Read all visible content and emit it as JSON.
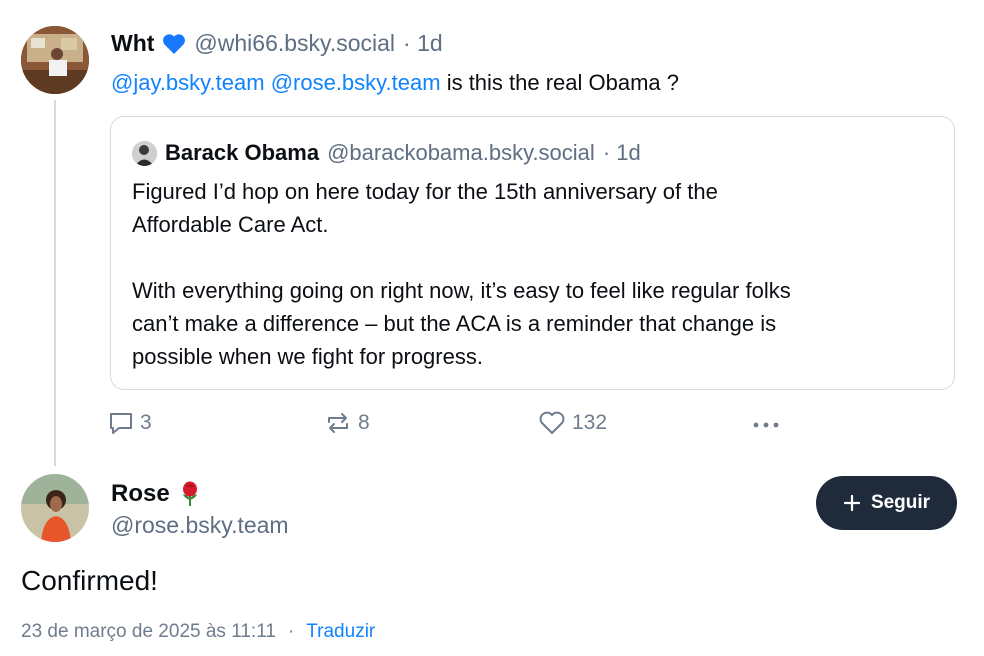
{
  "parent_post": {
    "author_name": "Wht",
    "author_emoji": "💙",
    "handle": "@whi66.bsky.social",
    "time": "· 1d",
    "text_mention_1": "@jay.bsky.team",
    "text_mention_2": "@rose.bsky.team",
    "text_rest": "is this the real Obama ?",
    "quote": {
      "author_name": "Barack Obama",
      "handle": "@barackobama.bsky.social",
      "time": "· 1d",
      "paragraph_1_line_1": "Figured I’d hop on here today for the 15th anniversary of the",
      "paragraph_1_line_2": "Affordable Care Act.",
      "paragraph_2_line_1": "With everything going on right now, it’s easy to feel like regular folks",
      "paragraph_2_line_2": "can’t make a difference – but the ACA is a reminder that change is",
      "paragraph_2_line_3": "possible when we fight for progress."
    },
    "actions": {
      "replies": "3",
      "reposts": "8",
      "likes": "132",
      "more_icon": "ellipsis-icon"
    }
  },
  "reply_post": {
    "author_name": "Rose",
    "author_emoji": "🌹",
    "handle": "@rose.bsky.team",
    "follow_label": "Seguir",
    "text": "Confirmed!",
    "timestamp": "23 de março de 2025 às 11:11",
    "separator": "·",
    "translate_label": "Traduzir"
  },
  "colors": {
    "mention": "#1083fe",
    "secondary_text": "#5f6e82",
    "button_bg": "#1f2b3b",
    "border": "#d4dbe2"
  }
}
